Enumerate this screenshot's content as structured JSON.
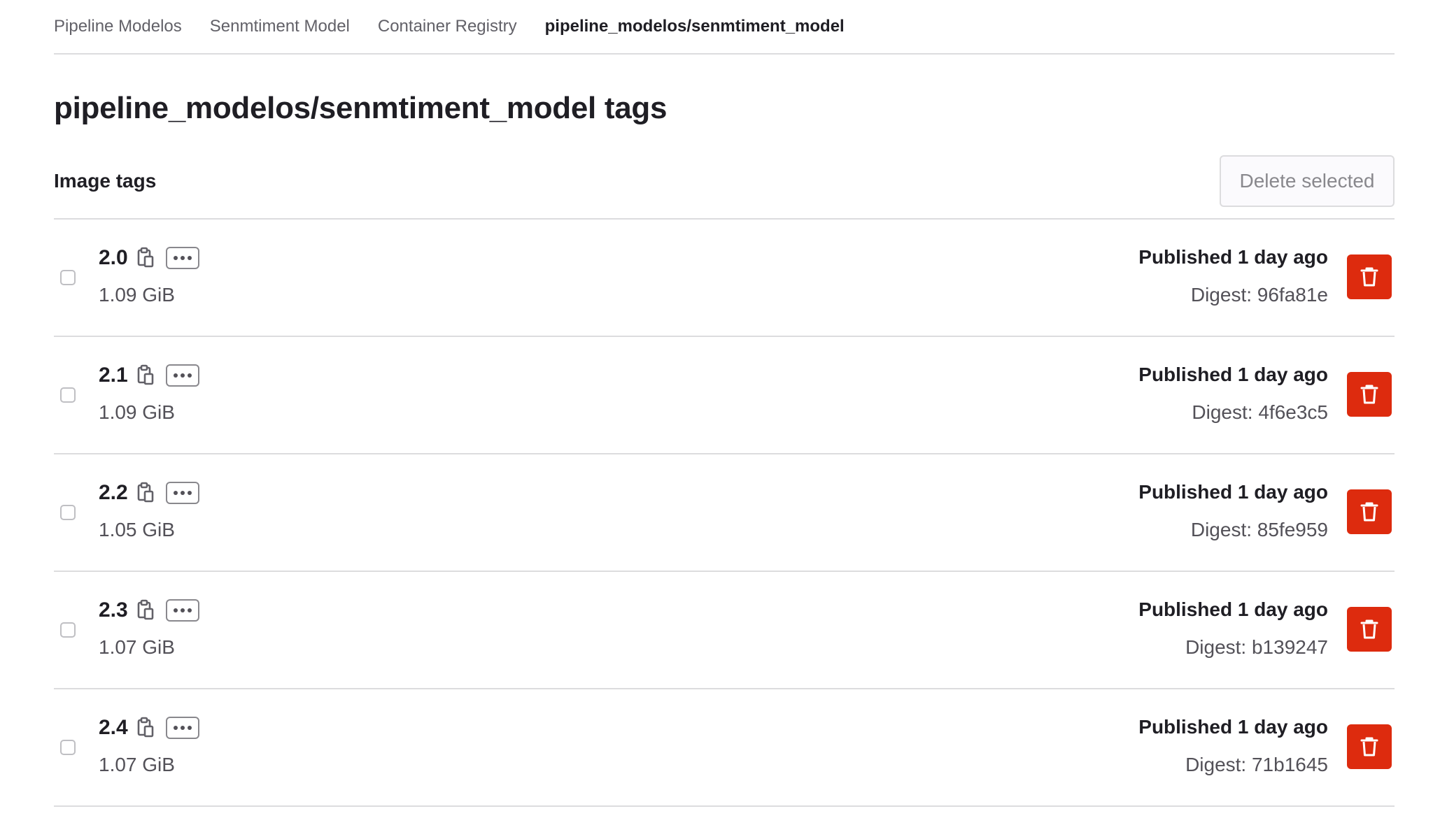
{
  "breadcrumb": [
    {
      "label": "Pipeline Modelos"
    },
    {
      "label": "Senmtiment Model"
    },
    {
      "label": "Container Registry"
    },
    {
      "label": "pipeline_modelos/senmtiment_model"
    }
  ],
  "page": {
    "title": "pipeline_modelos/senmtiment_model tags"
  },
  "section": {
    "title": "Image tags",
    "delete_selected_label": "Delete selected"
  },
  "tags": [
    {
      "name": "2.0",
      "size": "1.09 GiB",
      "published": "Published 1 day ago",
      "digest": "Digest: 96fa81e"
    },
    {
      "name": "2.1",
      "size": "1.09 GiB",
      "published": "Published 1 day ago",
      "digest": "Digest: 4f6e3c5"
    },
    {
      "name": "2.2",
      "size": "1.05 GiB",
      "published": "Published 1 day ago",
      "digest": "Digest: 85fe959"
    },
    {
      "name": "2.3",
      "size": "1.07 GiB",
      "published": "Published 1 day ago",
      "digest": "Digest: b139247"
    },
    {
      "name": "2.4",
      "size": "1.07 GiB",
      "published": "Published 1 day ago",
      "digest": "Digest: 71b1645"
    }
  ],
  "icons": {
    "copy": "copy-to-clipboard-icon",
    "more": "ellipsis-icon",
    "delete": "trash-icon"
  },
  "colors": {
    "danger": "#dd2b0e",
    "text_primary": "#1f1e24",
    "text_secondary": "#535158",
    "border": "#dcdcde"
  }
}
